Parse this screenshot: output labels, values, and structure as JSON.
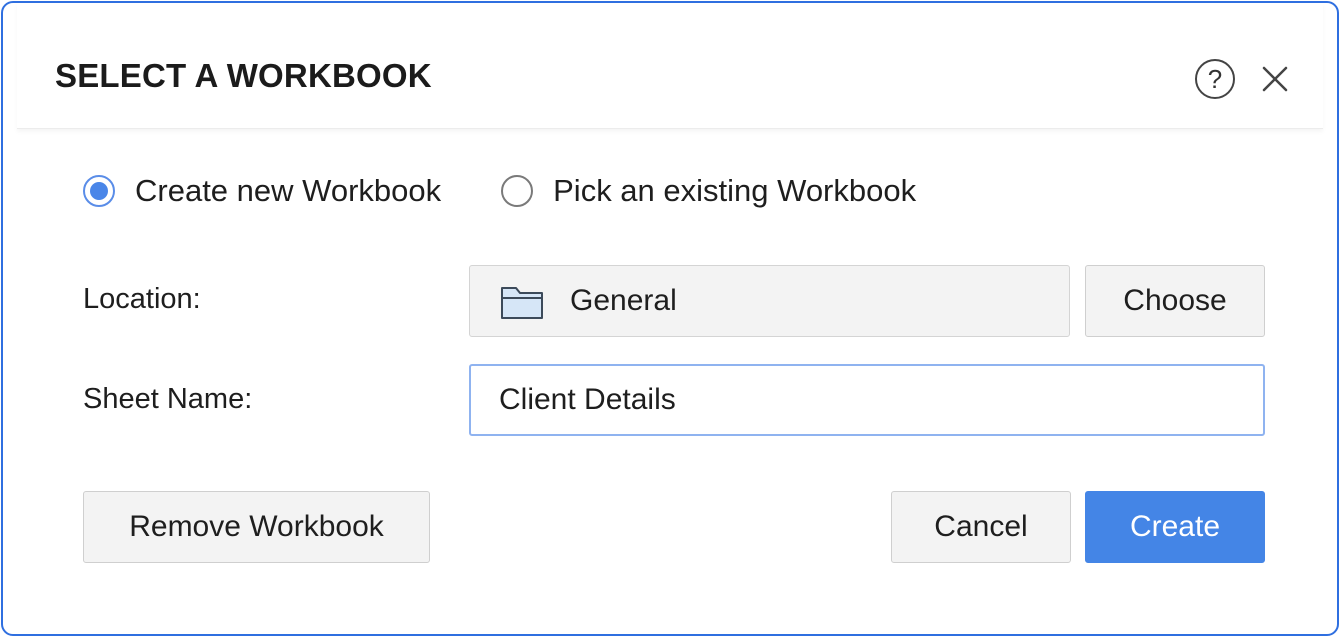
{
  "dialog": {
    "title": "SELECT A WORKBOOK",
    "help_glyph": "?",
    "icons": {
      "help": "help-circle-icon",
      "close": "close-icon",
      "folder": "folder-icon"
    }
  },
  "mode": {
    "options": [
      {
        "label": "Create new Workbook",
        "checked": true
      },
      {
        "label": "Pick an existing Workbook",
        "checked": false
      }
    ]
  },
  "form": {
    "location_label": "Location:",
    "location_value": "General",
    "choose_label": "Choose",
    "sheet_name_label": "Sheet Name:",
    "sheet_name_value": "Client Details"
  },
  "actions": {
    "remove_label": "Remove Workbook",
    "cancel_label": "Cancel",
    "create_label": "Create"
  },
  "colors": {
    "accent": "#4485e6",
    "frame_border": "#2f6fe0",
    "folder_fill": "#d6e6f7",
    "folder_stroke": "#3c4a5a"
  }
}
